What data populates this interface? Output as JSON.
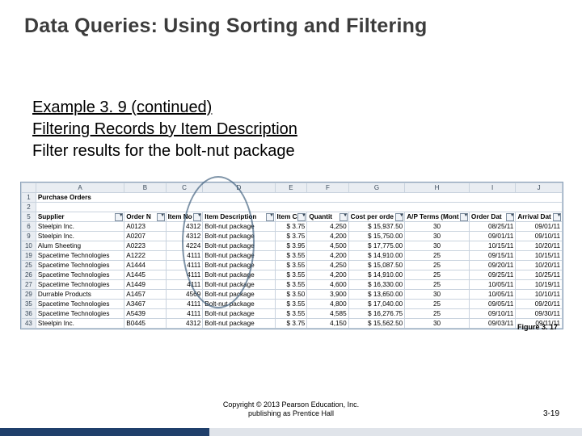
{
  "title": "Data Queries: Using Sorting and Filtering",
  "body": {
    "l1": "Example 3. 9  (continued)",
    "l2": "Filtering Records by Item Description",
    "l3": "Filter results for the bolt-nut package"
  },
  "sheet": {
    "topLabel": "Purchase Orders",
    "cols": [
      "A",
      "B",
      "C",
      "D",
      "E",
      "F",
      "G",
      "H",
      "I",
      "J"
    ],
    "hdrRow": "5",
    "headers": [
      "Supplier",
      "Order N",
      "Item No",
      "Item Description",
      "Item Co",
      "Quantit",
      "Cost per orde",
      "A/P Terms (Mont",
      "Order Dat",
      "Arrival Dat"
    ],
    "rows": [
      {
        "r": "6",
        "c": [
          "Steelpin Inc.",
          "A0123",
          "4312",
          "Bolt-nut package",
          "3.75",
          "4,250",
          "15,937.50",
          "30",
          "08/25/11",
          "09/01/11"
        ]
      },
      {
        "r": "9",
        "c": [
          "Steelpin Inc.",
          "A0207",
          "4312",
          "Bolt-nut package",
          "3.75",
          "4,200",
          "15,750.00",
          "30",
          "09/01/11",
          "09/10/11"
        ]
      },
      {
        "r": "10",
        "c": [
          "Alum Sheeting",
          "A0223",
          "4224",
          "Bolt-nut package",
          "3.95",
          "4,500",
          "17,775.00",
          "30",
          "10/15/11",
          "10/20/11"
        ]
      },
      {
        "r": "19",
        "c": [
          "Spacetime Technologies",
          "A1222",
          "4111",
          "Bolt-nut package",
          "3.55",
          "4,200",
          "14,910.00",
          "25",
          "09/15/11",
          "10/15/11"
        ]
      },
      {
        "r": "25",
        "c": [
          "Spacetime Technologies",
          "A1444",
          "4111",
          "Bolt-nut package",
          "3.55",
          "4,250",
          "15,087.50",
          "25",
          "09/20/11",
          "10/20/11"
        ]
      },
      {
        "r": "26",
        "c": [
          "Spacetime Technologies",
          "A1445",
          "4111",
          "Bolt-nut package",
          "3.55",
          "4,200",
          "14,910.00",
          "25",
          "09/25/11",
          "10/25/11"
        ]
      },
      {
        "r": "27",
        "c": [
          "Spacetime Technologies",
          "A1449",
          "4111",
          "Bolt-nut package",
          "3.55",
          "4,600",
          "16,330.00",
          "25",
          "10/05/11",
          "10/19/11"
        ]
      },
      {
        "r": "29",
        "c": [
          "Durrable Products",
          "A1457",
          "4569",
          "Bolt-nut package",
          "3.50",
          "3,900",
          "13,650.00",
          "30",
          "10/05/11",
          "10/10/11"
        ]
      },
      {
        "r": "35",
        "c": [
          "Spacetime Technologies",
          "A3467",
          "4111",
          "Bolt-nut package",
          "3.55",
          "4,800",
          "17,040.00",
          "25",
          "09/05/11",
          "09/20/11"
        ]
      },
      {
        "r": "36",
        "c": [
          "Spacetime Technologies",
          "A5439",
          "4111",
          "Bolt-nut package",
          "3.55",
          "4,585",
          "16,276.75",
          "25",
          "09/10/11",
          "09/30/11"
        ]
      },
      {
        "r": "43",
        "c": [
          "Steelpin Inc.",
          "B0445",
          "4312",
          "Bolt-nut package",
          "3.75",
          "4,150",
          "15,562.50",
          "30",
          "09/03/11",
          "09/11/11"
        ]
      }
    ]
  },
  "figure": "Figure 3. 17",
  "copyright1": "Copyright © 2013 Pearson Education, Inc.",
  "copyright2": "publishing as Prentice Hall",
  "page": "3-19",
  "chart_data": {
    "type": "table",
    "title": "Purchase Orders — filtered: Item Description = Bolt-nut package",
    "columns": [
      "Supplier",
      "Order No",
      "Item No",
      "Item Description",
      "Item Cost",
      "Quantity",
      "Cost per order",
      "A/P Terms (Months)",
      "Order Date",
      "Arrival Date"
    ],
    "rows": [
      [
        "Steelpin Inc.",
        "A0123",
        4312,
        "Bolt-nut package",
        3.75,
        4250,
        15937.5,
        30,
        "08/25/11",
        "09/01/11"
      ],
      [
        "Steelpin Inc.",
        "A0207",
        4312,
        "Bolt-nut package",
        3.75,
        4200,
        15750.0,
        30,
        "09/01/11",
        "09/10/11"
      ],
      [
        "Alum Sheeting",
        "A0223",
        4224,
        "Bolt-nut package",
        3.95,
        4500,
        17775.0,
        30,
        "10/15/11",
        "10/20/11"
      ],
      [
        "Spacetime Technologies",
        "A1222",
        4111,
        "Bolt-nut package",
        3.55,
        4200,
        14910.0,
        25,
        "09/15/11",
        "10/15/11"
      ],
      [
        "Spacetime Technologies",
        "A1444",
        4111,
        "Bolt-nut package",
        3.55,
        4250,
        15087.5,
        25,
        "09/20/11",
        "10/20/11"
      ],
      [
        "Spacetime Technologies",
        "A1445",
        4111,
        "Bolt-nut package",
        3.55,
        4200,
        14910.0,
        25,
        "09/25/11",
        "10/25/11"
      ],
      [
        "Spacetime Technologies",
        "A1449",
        4111,
        "Bolt-nut package",
        3.55,
        4600,
        16330.0,
        25,
        "10/05/11",
        "10/19/11"
      ],
      [
        "Durrable Products",
        "A1457",
        4569,
        "Bolt-nut package",
        3.5,
        3900,
        13650.0,
        30,
        "10/05/11",
        "10/10/11"
      ],
      [
        "Spacetime Technologies",
        "A3467",
        4111,
        "Bolt-nut package",
        3.55,
        4800,
        17040.0,
        25,
        "09/05/11",
        "09/20/11"
      ],
      [
        "Spacetime Technologies",
        "A5439",
        4111,
        "Bolt-nut package",
        3.55,
        4585,
        16276.75,
        25,
        "09/10/11",
        "09/30/11"
      ],
      [
        "Steelpin Inc.",
        "B0445",
        4312,
        "Bolt-nut package",
        3.75,
        4150,
        15562.5,
        30,
        "09/03/11",
        "09/11/11"
      ]
    ]
  }
}
